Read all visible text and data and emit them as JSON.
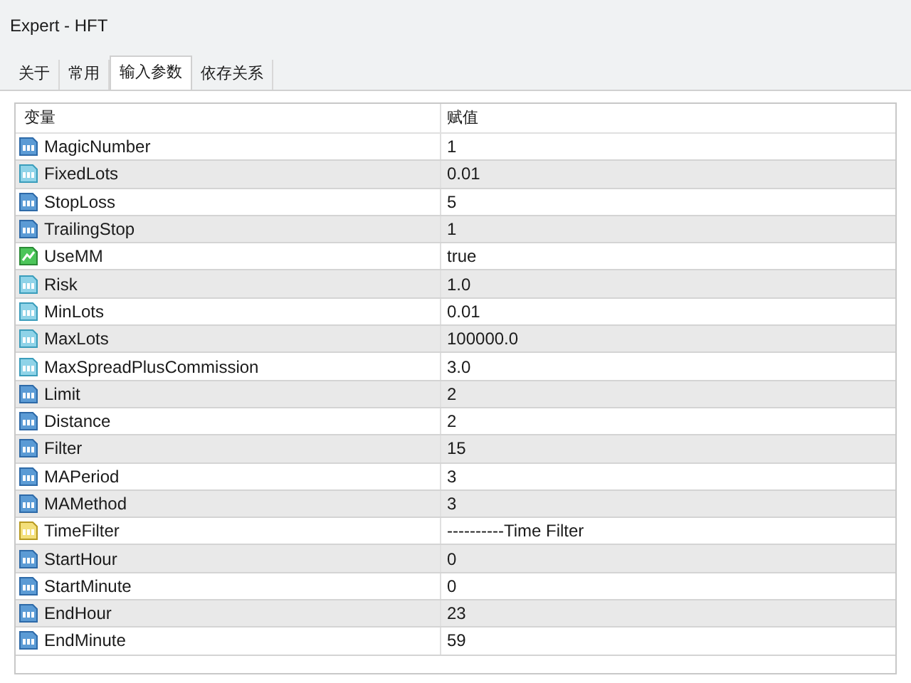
{
  "window": {
    "title": "Expert - HFT"
  },
  "tabs": [
    {
      "label": "关于",
      "selected": false
    },
    {
      "label": "常用",
      "selected": false
    },
    {
      "label": "输入参数",
      "selected": true
    },
    {
      "label": "依存关系",
      "selected": false
    }
  ],
  "table": {
    "columns": [
      "变量",
      "赋值"
    ],
    "rows": [
      {
        "kind": "int",
        "name": "MagicNumber",
        "value": "1"
      },
      {
        "kind": "double",
        "name": "FixedLots",
        "value": "0.01"
      },
      {
        "kind": "int",
        "name": "StopLoss",
        "value": "5"
      },
      {
        "kind": "int",
        "name": "TrailingStop",
        "value": "1"
      },
      {
        "kind": "bool",
        "name": "UseMM",
        "value": "true"
      },
      {
        "kind": "double",
        "name": "Risk",
        "value": "1.0"
      },
      {
        "kind": "double",
        "name": "MinLots",
        "value": "0.01"
      },
      {
        "kind": "double",
        "name": "MaxLots",
        "value": "100000.0"
      },
      {
        "kind": "double",
        "name": "MaxSpreadPlusCommission",
        "value": "3.0"
      },
      {
        "kind": "int",
        "name": "Limit",
        "value": "2"
      },
      {
        "kind": "int",
        "name": "Distance",
        "value": "2"
      },
      {
        "kind": "int",
        "name": "Filter",
        "value": "15"
      },
      {
        "kind": "int",
        "name": "MAPeriod",
        "value": "3"
      },
      {
        "kind": "int",
        "name": "MAMethod",
        "value": "3"
      },
      {
        "kind": "string",
        "name": "TimeFilter",
        "value": "----------Time Filter"
      },
      {
        "kind": "int",
        "name": "StartHour",
        "value": "0"
      },
      {
        "kind": "int",
        "name": "StartMinute",
        "value": "0"
      },
      {
        "kind": "int",
        "name": "EndHour",
        "value": "23"
      },
      {
        "kind": "int",
        "name": "EndMinute",
        "value": "59"
      }
    ]
  }
}
